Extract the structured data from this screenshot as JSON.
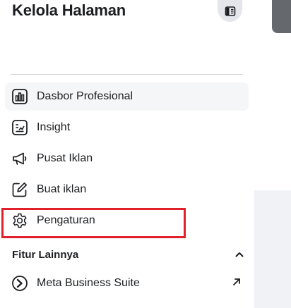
{
  "header": {
    "title": "Kelola Halaman"
  },
  "nav": {
    "items": [
      {
        "label": "Dasbor Profesional",
        "icon": "dashboard-icon"
      },
      {
        "label": "Insight",
        "icon": "insight-icon"
      },
      {
        "label": "Pusat Iklan",
        "icon": "megaphone-icon"
      },
      {
        "label": "Buat iklan",
        "icon": "edit-icon"
      },
      {
        "label": "Pengaturan",
        "icon": "gear-icon"
      }
    ]
  },
  "more_features": {
    "title": "Fitur Lainnya",
    "items": [
      {
        "label": "Meta Business Suite",
        "icon": "meta-business-suite-icon"
      }
    ]
  },
  "colors": {
    "highlight": "#e0202a",
    "text": "#1c1e21",
    "active_bg": "#f5f6f7"
  }
}
